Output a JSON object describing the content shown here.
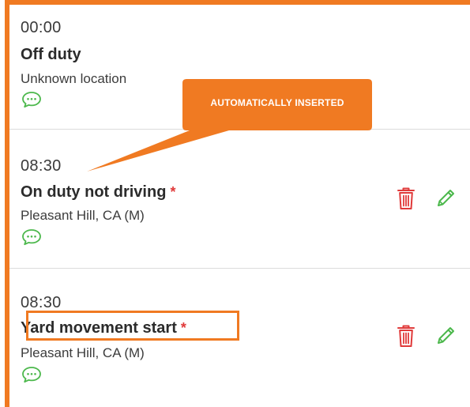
{
  "events": [
    {
      "time": "00:00",
      "status": "Off duty",
      "required_mark": "",
      "location": "Unknown location"
    },
    {
      "time": "08:30",
      "status": "On duty not driving",
      "required_mark": "*",
      "location": "Pleasant Hill, CA (M)"
    },
    {
      "time": "08:30",
      "status": "Yard movement start",
      "required_mark": "*",
      "location": "Pleasant Hill, CA (M)"
    }
  ],
  "callout": {
    "text": "AUTOMATICALLY INSERTED"
  },
  "colors": {
    "accent": "#f07a22",
    "chat_icon": "#4cb84c",
    "trash_icon": "#e03a3a",
    "pencil_icon": "#4cb84c",
    "required": "#e03a3a"
  },
  "icons": {
    "comment": "chat-bubble-icon",
    "delete": "trash-icon",
    "edit": "pencil-icon"
  }
}
